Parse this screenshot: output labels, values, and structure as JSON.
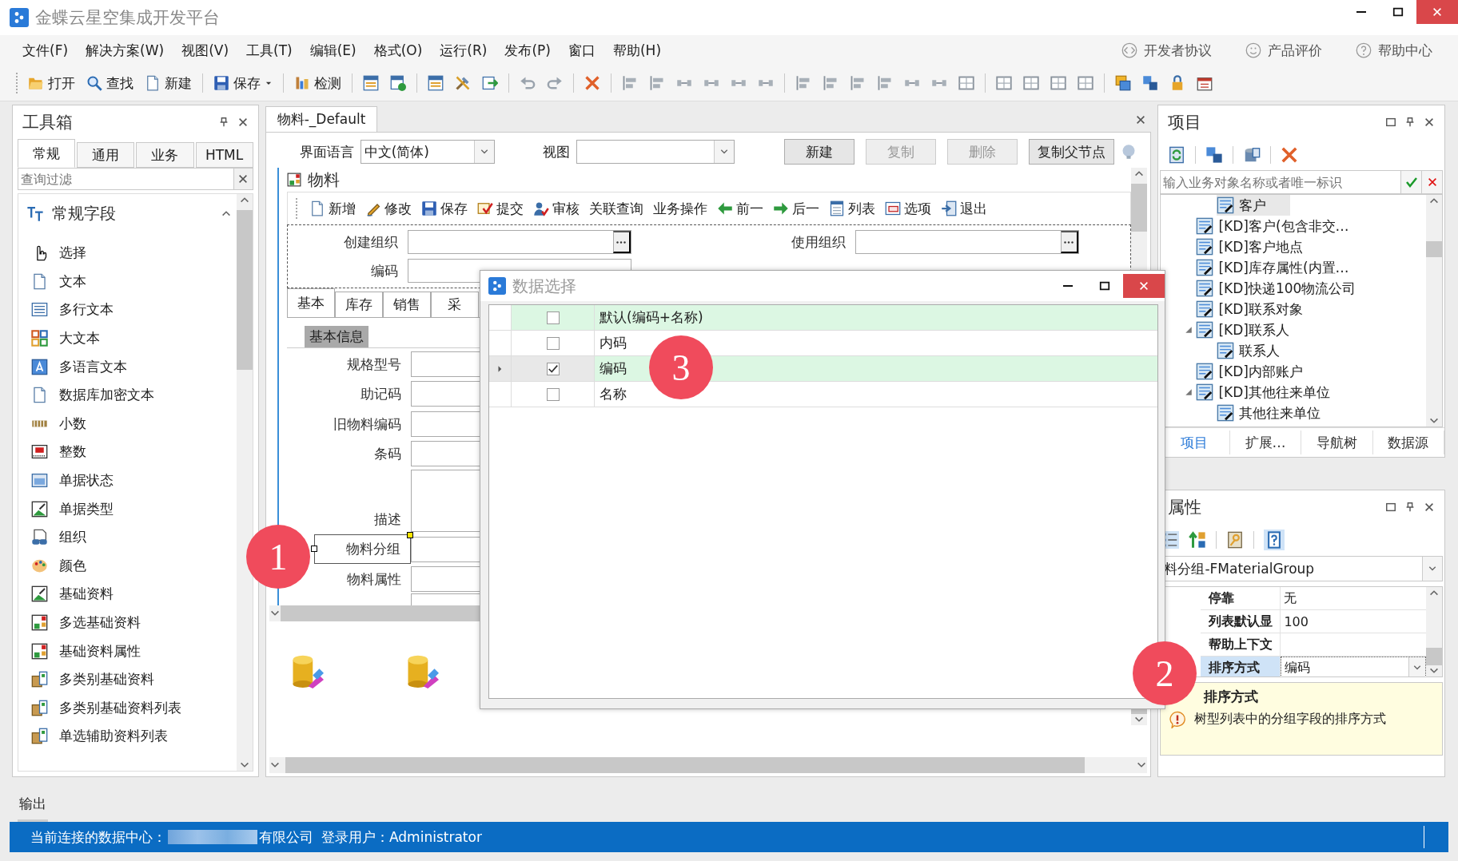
{
  "window": {
    "title": "金蝶云星空集成开发平台"
  },
  "menu": [
    "文件(F)",
    "解决方案(W)",
    "视图(V)",
    "工具(T)",
    "编辑(E)",
    "格式(O)",
    "运行(R)",
    "发布(P)",
    "窗口",
    "帮助(H)"
  ],
  "menu_links": [
    "开发者协议",
    "产品评价",
    "帮助中心"
  ],
  "toolbar": [
    {
      "label": "打开",
      "dropdown": false
    },
    {
      "label": "查找",
      "dropdown": false
    },
    {
      "label": "新建",
      "dropdown": false
    },
    {
      "label": "保存",
      "dropdown": true
    },
    {
      "label": "检测",
      "dropdown": false
    }
  ],
  "toolbox": {
    "title": "工具箱",
    "tabs": [
      {
        "label": "常规",
        "selected": true
      },
      {
        "label": "通用",
        "selected": false
      },
      {
        "label": "业务",
        "selected": false
      },
      {
        "label": "HTML",
        "selected": false
      }
    ],
    "filter": {
      "placeholder": "查询过滤"
    },
    "group": {
      "label": "常规字段",
      "expanded": true
    },
    "items": [
      "选择",
      "文本",
      "多行文本",
      "大文本",
      "多语言文本",
      "数据库加密文本",
      "小数",
      "整数",
      "单据状态",
      "单据类型",
      "组织",
      "颜色",
      "基础资料",
      "多选基础资料",
      "基础资料属性",
      "多类别基础资料",
      "多类别基础资料列表",
      "单选辅助资料列表"
    ]
  },
  "document": {
    "tab": "物料-_Default",
    "language_label": "界面语言",
    "language": "中文(简体)",
    "view_label": "视图",
    "buttons": [
      {
        "label": "新建",
        "disabled": false
      },
      {
        "label": "复制",
        "disabled": true
      },
      {
        "label": "删除",
        "disabled": true
      },
      {
        "label": "复制父节点",
        "disabled": false
      }
    ],
    "form_title": "物料",
    "form_toolbar": [
      {
        "label": "新增",
        "kind": "icon"
      },
      {
        "label": "修改",
        "kind": "icon"
      },
      {
        "label": "保存",
        "kind": "icon"
      },
      {
        "label": "提交",
        "kind": "icon"
      },
      {
        "label": "审核",
        "kind": "icon"
      },
      {
        "label": "关联查询",
        "kind": "text"
      },
      {
        "label": "业务操作",
        "kind": "text"
      },
      {
        "label": "前一",
        "kind": "icon"
      },
      {
        "label": "后一",
        "kind": "icon"
      },
      {
        "label": "列表",
        "kind": "icon"
      },
      {
        "label": "选项",
        "kind": "icon"
      },
      {
        "label": "退出",
        "kind": "icon"
      }
    ],
    "header_fields": [
      {
        "label": "创建组织"
      },
      {
        "label": "使用组织"
      }
    ],
    "code_label": "编码",
    "tabs": [
      {
        "label": "基本",
        "selected": true
      },
      {
        "label": "库存",
        "selected": false
      },
      {
        "label": "销售",
        "selected": false
      },
      {
        "label": "采",
        "selected": false
      }
    ],
    "section": "基本信息",
    "fields": [
      {
        "label": "规格型号",
        "kind": "line",
        "selected": false
      },
      {
        "label": "助记码",
        "kind": "line",
        "selected": false
      },
      {
        "label": "旧物料编码",
        "kind": "line",
        "selected": false
      },
      {
        "label": "条码",
        "kind": "line",
        "selected": false
      },
      {
        "label": "描述",
        "kind": "multiline",
        "selected": false
      },
      {
        "label": "物料分组",
        "kind": "line",
        "selected": true
      },
      {
        "label": "物料属性",
        "kind": "line",
        "selected": false
      }
    ]
  },
  "dialog": {
    "title": "数据选择",
    "rows": [
      {
        "label": "默认(编码+名称)",
        "checked": false,
        "highlighted": true,
        "current": false
      },
      {
        "label": "内码",
        "checked": false,
        "highlighted": false,
        "current": false
      },
      {
        "label": "编码",
        "checked": true,
        "highlighted": true,
        "current": true
      },
      {
        "label": "名称",
        "checked": false,
        "highlighted": false,
        "current": false
      }
    ]
  },
  "project": {
    "title": "项目",
    "search": {
      "placeholder": "输入业务对象名称或者唯一标识"
    },
    "tree": [
      {
        "children": [
          {
            "label": "客户",
            "selected": true
          }
        ]
      },
      {
        "label": "[KD]客户(包含非交…",
        "selected": false
      },
      {
        "label": "[KD]客户地点",
        "selected": false
      },
      {
        "label": "[KD]库存属性(内置…",
        "selected": false
      },
      {
        "label": "[KD]快递100物流公司",
        "selected": false
      },
      {
        "label": "[KD]联系对象",
        "selected": false
      },
      {
        "label": "[KD]联系人",
        "selected": false,
        "expanded": true,
        "children": [
          {
            "label": "联系人",
            "selected": false
          }
        ]
      },
      {
        "label": "[KD]内部账户",
        "selected": false
      },
      {
        "label": "[KD]其他往来单位",
        "selected": false,
        "expanded": true,
        "children": [
          {
            "label": "其他往来单位",
            "selected": false
          }
        ]
      }
    ],
    "tabs": [
      {
        "label": "项目",
        "selected": true
      },
      {
        "label": "扩展…",
        "selected": false
      },
      {
        "label": "导航树",
        "selected": false
      },
      {
        "label": "数据源",
        "selected": false
      }
    ]
  },
  "properties": {
    "title": "属性",
    "object": "料分组-FMaterialGroup",
    "rows": [
      {
        "name": "停靠",
        "value": "无",
        "selected": false,
        "kind": "text"
      },
      {
        "name": "列表默认显",
        "value": "100",
        "selected": false,
        "kind": "text"
      },
      {
        "name": "帮助上下文",
        "selected": false,
        "kind": "text"
      },
      {
        "name": "排序方式",
        "value": "编码",
        "selected": true,
        "kind": "dropdown"
      }
    ],
    "help_title": "排序方式",
    "help_text": "树型列表中的分组字段的排序方式"
  },
  "output": {
    "label": "输出"
  },
  "status_bar": {
    "connection_label": "当前连接的数据中心：",
    "company_suffix": "有限公司",
    "user": "登录用户：Administrator"
  },
  "annotations": [
    "1",
    "2",
    "3"
  ]
}
